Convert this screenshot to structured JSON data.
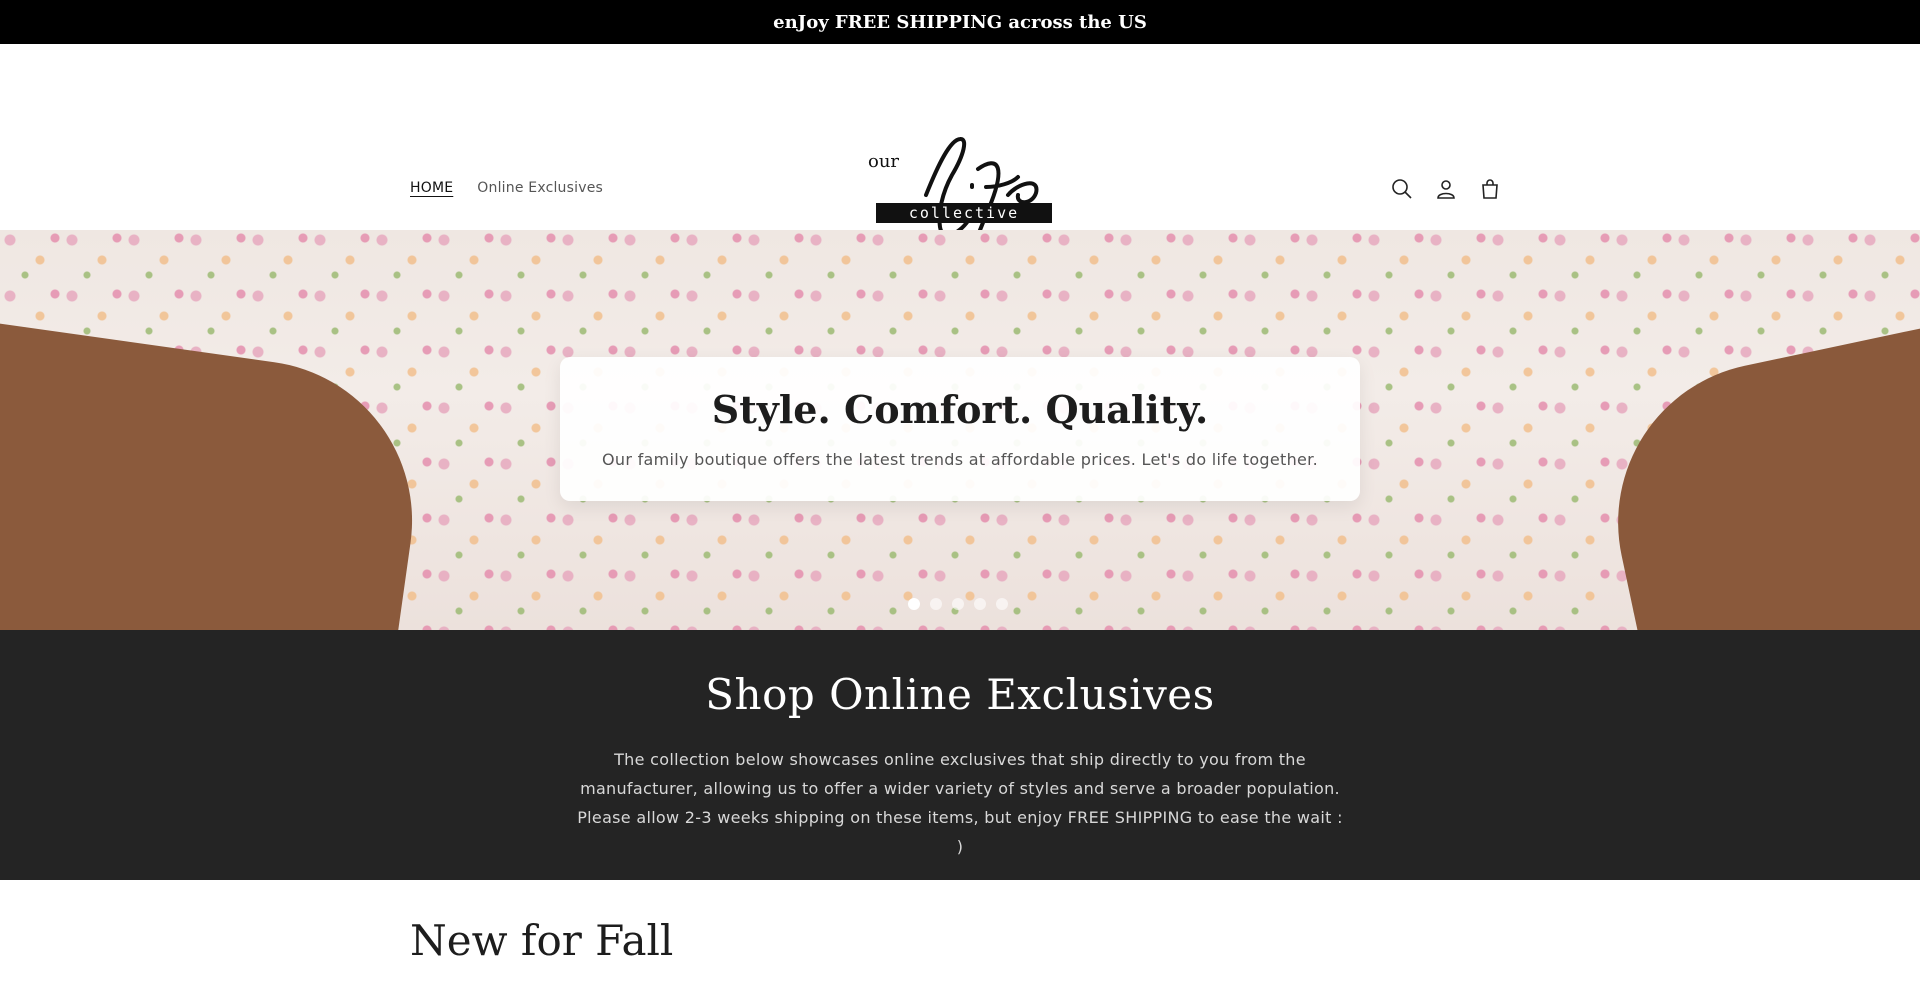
{
  "announcement": {
    "text": "enJoy FREE SHIPPING across the US"
  },
  "nav": {
    "items": [
      {
        "label": "HOME",
        "active": true
      },
      {
        "label": "Online Exclusives",
        "active": false
      }
    ]
  },
  "logo": {
    "text_our": "our",
    "text_life": "Life",
    "text_collective": "collective"
  },
  "header_icons": [
    "search-icon",
    "account-icon",
    "cart-icon"
  ],
  "hero": {
    "title": "Style. Comfort. Quality.",
    "subtitle": "Our family boutique offers the latest trends at affordable prices. Let's do life together.",
    "slide_count": 5,
    "active_slide": 1
  },
  "exclusives": {
    "title": "Shop Online Exclusives",
    "description": "The collection below showcases online exclusives that ship directly to you from the manufacturer, allowing us to offer a wider variety of styles and serve a broader population. Please allow 2-3 weeks shipping on these items, but enjoy FREE SHIPPING to ease the wait : )"
  },
  "new_section": {
    "title": "New for Fall"
  },
  "colors": {
    "announcement_bg": "#000000",
    "exclusives_bg": "#242424"
  }
}
